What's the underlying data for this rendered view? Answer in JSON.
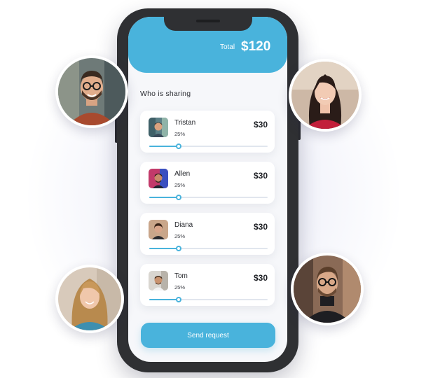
{
  "header": {
    "total_label": "Total",
    "total_value": "$120"
  },
  "section": {
    "title": "Who is sharing"
  },
  "participants": [
    {
      "name": "Tristan",
      "percent": "25%",
      "amount": "$30",
      "share": 0.25
    },
    {
      "name": "Allen",
      "percent": "25%",
      "amount": "$30",
      "share": 0.25
    },
    {
      "name": "Diana",
      "percent": "25%",
      "amount": "$30",
      "share": 0.25
    },
    {
      "name": "Tom",
      "percent": "25%",
      "amount": "$30",
      "share": 0.25
    }
  ],
  "actions": {
    "send_request_label": "Send request"
  },
  "colors": {
    "accent": "#49b3dc",
    "phone_frame": "#2f3033",
    "screen_bg": "#f6f7fa"
  }
}
